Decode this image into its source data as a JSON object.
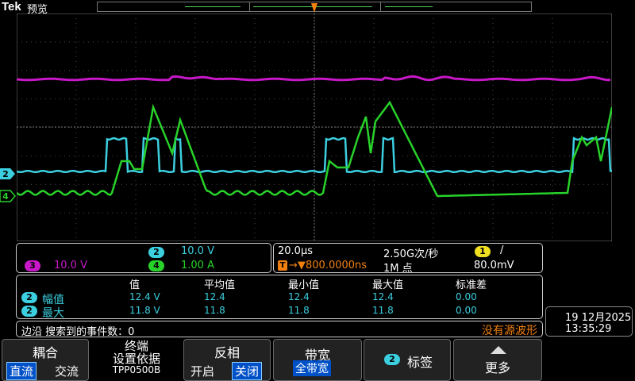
{
  "header": {
    "brand": "Tek",
    "mode": "预览"
  },
  "trigger_marker": "T",
  "channel_markers": [
    {
      "label": "2",
      "color": "#3ccfe0"
    },
    {
      "label": "4",
      "color": "#28d22a"
    }
  ],
  "channels": {
    "ch3": {
      "label": "3",
      "scale": "10.0 V",
      "color": "#c818c8"
    },
    "ch2": {
      "label": "2",
      "scale": "10.0 V",
      "color": "#3ccfe0"
    },
    "ch4": {
      "label": "4",
      "scale": "1.00 A",
      "color": "#28d22a"
    }
  },
  "timebase": {
    "time_div": "20.0µs",
    "sample_rate": "2.50G次/秒",
    "trigger_pos": "800.0000ns",
    "record_len": "1M 点",
    "trig_src": "1",
    "trig_slope": "/",
    "trig_level": "80.0mV"
  },
  "measurements": {
    "headers": [
      "值",
      "平均值",
      "最小值",
      "最大值",
      "标准差"
    ],
    "rows": [
      {
        "ch": "2",
        "name": "幅值",
        "values": [
          "12.4 V",
          "12.4",
          "12.4",
          "12.4",
          "0.00"
        ]
      },
      {
        "ch": "2",
        "name": "最大",
        "values": [
          "11.8 V",
          "11.8",
          "11.8",
          "11.8",
          "0.00"
        ]
      }
    ]
  },
  "search": {
    "label": "边沿 搜索到的事件数：0",
    "warning": "没有源波形"
  },
  "datetime": {
    "date": "19 12月2025",
    "time": "13:35:29"
  },
  "buttons": {
    "coupling": {
      "title": "耦合",
      "opt1": "直流",
      "opt2": "交流"
    },
    "termination": {
      "line1": "终端",
      "line2": "设置依据",
      "line3": "TPP0500B"
    },
    "invert": {
      "title": "反相",
      "opt1": "开启",
      "opt2": "关闭"
    },
    "bandwidth": {
      "title": "带宽",
      "value": "全带宽"
    },
    "label": {
      "ch": "2",
      "title": "标签"
    },
    "more": {
      "title": "更多"
    }
  },
  "colors": {
    "ch1": "#f0e020",
    "ch2": "#3ccfe0",
    "ch3": "#c818c8",
    "ch4": "#28d22a",
    "trigger": "#f08010",
    "warning": "#f08010",
    "selected": "#0050c8"
  }
}
